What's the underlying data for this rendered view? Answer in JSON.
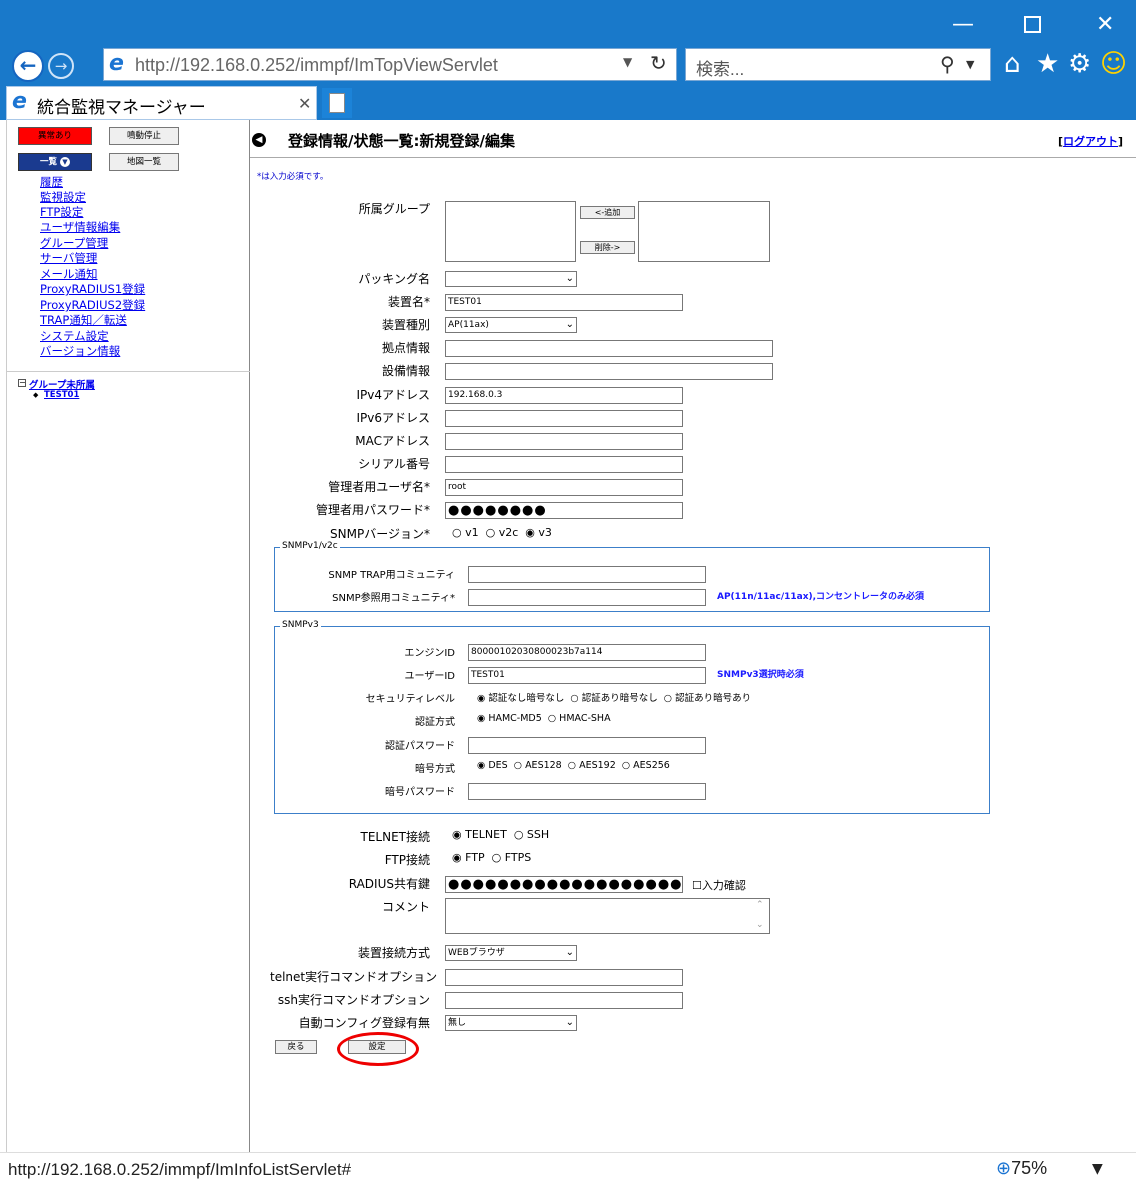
{
  "browser": {
    "url": "http://192.168.0.252/immpf/ImTopViewServlet",
    "search_placeholder": "検索...",
    "tab_title": "統合監視マネージャー",
    "status_url": "http://192.168.0.252/immpf/ImInfoListServlet#",
    "zoom": "75%"
  },
  "sidebar": {
    "alarm": "異常あり",
    "mute": "鳴動停止",
    "list": "一覧",
    "map": "地図一覧",
    "nav": [
      "履歴",
      "監視設定",
      "FTP設定",
      "ユーザ情報編集",
      "グループ管理",
      "サーバ管理",
      "メール通知",
      "ProxyRADIUS1登録",
      "ProxyRADIUS2登録",
      "TRAP通知／転送",
      "システム設定",
      "バージョン情報"
    ],
    "tree_group": "グループ未所属",
    "tree_item": "TEST01"
  },
  "header": {
    "title": "登録情報/状態一覧:新規登録/編集",
    "logout_pre": "[",
    "logout": "ログアウト",
    "logout_post": "]"
  },
  "form": {
    "required_note": "*は入力必須です。",
    "group_label": "所属グループ",
    "add_btn": "<-追加",
    "del_btn": "削除->",
    "packing_label": "パッキング名",
    "packing_value": "",
    "device_name_label": "装置名*",
    "device_name": "TEST01",
    "device_type_label": "装置種別",
    "device_type": "AP(11ax)",
    "site_label": "拠点情報",
    "site": "",
    "equip_label": "設備情報",
    "equip": "",
    "ipv4_label": "IPv4アドレス",
    "ipv4": "192.168.0.3",
    "ipv6_label": "IPv6アドレス",
    "ipv6": "",
    "mac_label": "MACアドレス",
    "mac": "",
    "serial_label": "シリアル番号",
    "serial": "",
    "admin_user_label": "管理者用ユーザ名*",
    "admin_user": "root",
    "admin_pw_label": "管理者用パスワード*",
    "admin_pw": "●●●●●●●●",
    "snmp_ver_label": "SNMPバージョン*",
    "snmp_v1": "v1",
    "snmp_v2c": "v2c",
    "snmp_v3": "v3",
    "v12": {
      "legend": "SNMPv1/v2c",
      "trap_label": "SNMP TRAP用コミュニティ",
      "trap": "",
      "ref_label": "SNMP参照用コミュニティ*",
      "ref": "",
      "hint": "AP(11n/11ac/11ax),コンセントレータのみ必須"
    },
    "v3": {
      "legend": "SNMPv3",
      "engine_label": "エンジンID",
      "engine": "80000102030800023b7a114",
      "user_label": "ユーザーID",
      "user": "TEST01",
      "user_hint": "SNMPv3選択時必須",
      "sec_label": "セキュリティレベル",
      "sec1": "認証なし暗号なし",
      "sec2": "認証あり暗号なし",
      "sec3": "認証あり暗号あり",
      "auth_label": "認証方式",
      "auth1": "HAMC-MD5",
      "auth2": "HMAC-SHA",
      "authpw_label": "認証パスワード",
      "authpw": "",
      "enc_label": "暗号方式",
      "enc1": "DES",
      "enc2": "AES128",
      "enc3": "AES192",
      "enc4": "AES256",
      "encpw_label": "暗号パスワード",
      "encpw": ""
    },
    "telnet_label": "TELNET接続",
    "telnet1": "TELNET",
    "telnet2": "SSH",
    "ftp_label": "FTP接続",
    "ftp1": "FTP",
    "ftp2": "FTPS",
    "radius_label": "RADIUS共有鍵",
    "radius": "●●●●●●●●●●●●●●●●●●●●●●●",
    "confirm": "入力確認",
    "comment_label": "コメント",
    "comment": "",
    "conn_label": "装置接続方式",
    "conn": "WEBブラウザ",
    "telnet_opt_label": "telnet実行コマンドオプション",
    "telnet_opt": "",
    "ssh_opt_label": "ssh実行コマンドオプション",
    "ssh_opt": "",
    "autocfg_label": "自動コンフィグ登録有無",
    "autocfg": "無し",
    "back_btn": "戻る",
    "set_btn": "設定"
  }
}
